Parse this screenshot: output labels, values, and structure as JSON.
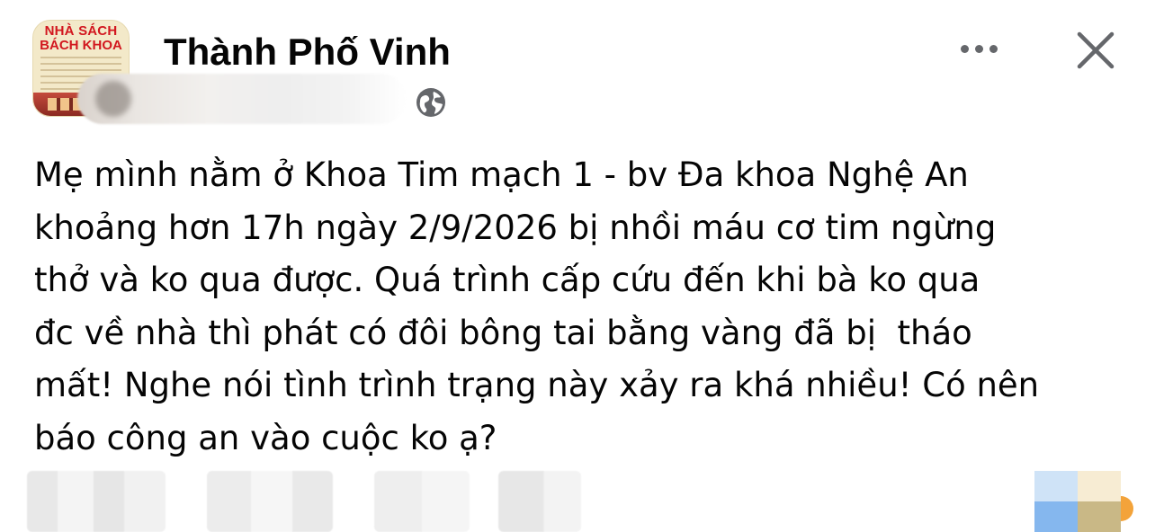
{
  "header": {
    "avatar": {
      "brand_line_1": "NHÀ SÁCH",
      "brand_line_2": "BÁCH KHOA"
    },
    "page_name": "Thành Phố Vinh",
    "privacy_icon": "globe-icon",
    "more_icon": "more-horizontal-icon",
    "close_icon": "close-icon"
  },
  "post": {
    "text": "Mẹ mình nằm ở Khoa Tim mạch 1 - bv Đa khoa Nghệ An\nkhoảng hơn 17h ngày 2/9/2026 bị nhồi máu cơ tim ngừng\nthở và ko qua được. Quá trình cấp cứu đến khi bà ko qua\nđc về nhà thì phát có đôi bông tai bằng vàng đã bị  tháo\nmất! Nghe nói tình trình trạng này xảy ra khá nhiều! Có nên\nbáo công an vào cuộc ko ạ?"
  },
  "colors": {
    "text": "#050505",
    "secondary_icon": "#65676b",
    "brand_red": "#d2171f"
  }
}
